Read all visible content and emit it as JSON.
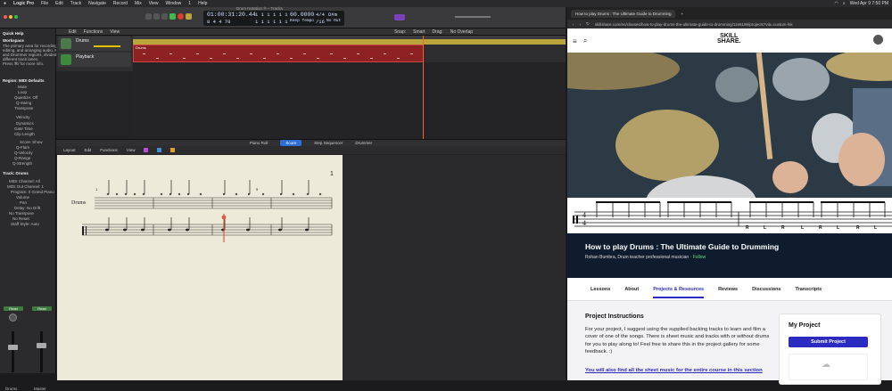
{
  "menubar": {
    "app": "Logic Pro",
    "items": [
      "File",
      "Edit",
      "Track",
      "Navigate",
      "Record",
      "Mix",
      "View",
      "Window",
      "1",
      "Help"
    ],
    "clock": "Wed Apr 9 7:50 PM"
  },
  "transport": {
    "time": "01:00:31:20.44",
    "time_sub": "8 4 4 70",
    "pos1": "1 1 1",
    "pos2": "1 1 1",
    "pos3": "1 1 1",
    "pos4": "1 1 1",
    "tempo": "60.0000",
    "tempo_label": "Keep Tempo",
    "sig": "4/4",
    "sig_sub": "/16",
    "key": "D#m",
    "key_sub": "No Out",
    "project_title": "Drum Notation ® – Tracks"
  },
  "inspector": {
    "quickhelp": "Quick Help",
    "qh_title": "Workspace",
    "qh_text": [
      "The primary area for recording,",
      "editing, and arranging audio, MIDI",
      "and Drummer regions, divided into",
      "different track lanes.",
      "Press ⌘/ for more info."
    ],
    "region_header": "Region: MIDI Defaults",
    "fields": [
      "Mute",
      "Loop",
      "Quantize: Off",
      "Q-Swing",
      "Transpose",
      "Velocity",
      "Dynamics",
      "Gate Time",
      "Clip Length",
      "Score: Show",
      "Q-Flam",
      "Q-Velocity",
      "Q-Range",
      "Q-Strength"
    ],
    "track_header": "Track: Drums",
    "track_fields": [
      "MIDI Channel: All",
      "MIDI Out Channel: 1",
      "Program: 0 Grand Piano",
      "Volume",
      "Pan",
      "Delay: No Drift",
      "No Transpose",
      "No Reset",
      "Staff Style: Auto"
    ],
    "ch1": "Read",
    "ch2": "Read",
    "ch1_name": "Drums",
    "ch2_name": "Master"
  },
  "tracks": {
    "toolbar": [
      "Edit",
      "Functions",
      "View"
    ],
    "track1": "Drums",
    "track2": "Playback",
    "region": "Drums",
    "region2": "Drums",
    "snap_label": "Snap:",
    "snap": "Smart",
    "drag_label": "Drag:",
    "drag": "No Overlap"
  },
  "editor": {
    "tabs": [
      "Piano Roll",
      "Score",
      "Step Sequencer",
      "Drummer"
    ],
    "tools": [
      "Layout",
      "Edit",
      "Functions",
      "View"
    ],
    "instrument": "Drums",
    "page": "1",
    "bar5": "5"
  },
  "browser": {
    "tab": "How to play Drums : The Ultimate Guide to Drumming",
    "url": "skillshare.com/en/classes/how-to-play-drums-the-ultimate-guide-to-drumming/1165186/projects?via=custom-lnk",
    "logo1": "SKILL",
    "logo2": "SHARE.",
    "sticking": [
      "R",
      "L",
      "R",
      "L",
      "R",
      "L",
      "R",
      "L"
    ],
    "title": "How to play Drums : The Ultimate Guide to Drumming",
    "author": "Rohan Bumbra, Drum teacher professional musician",
    "follow": "Follow",
    "tabs": [
      "Lessons",
      "About",
      "Projects & Resources",
      "Reviews",
      "Discussions",
      "Transcripts"
    ],
    "active_tab": "Projects & Resources",
    "pi_title": "Project Instructions",
    "pi_body": "For your project, I suggest using the supplied backing tracks to learn and film a cover of one of the songs. There is sheet music and tracks with or without drums for you to play along to! Feel free to share this in the project gallery for some feedback. :)",
    "pi_link": "You will also find all the sheet music for the entire course in this section",
    "myproject": "My Project",
    "submit": "Submit Project"
  }
}
